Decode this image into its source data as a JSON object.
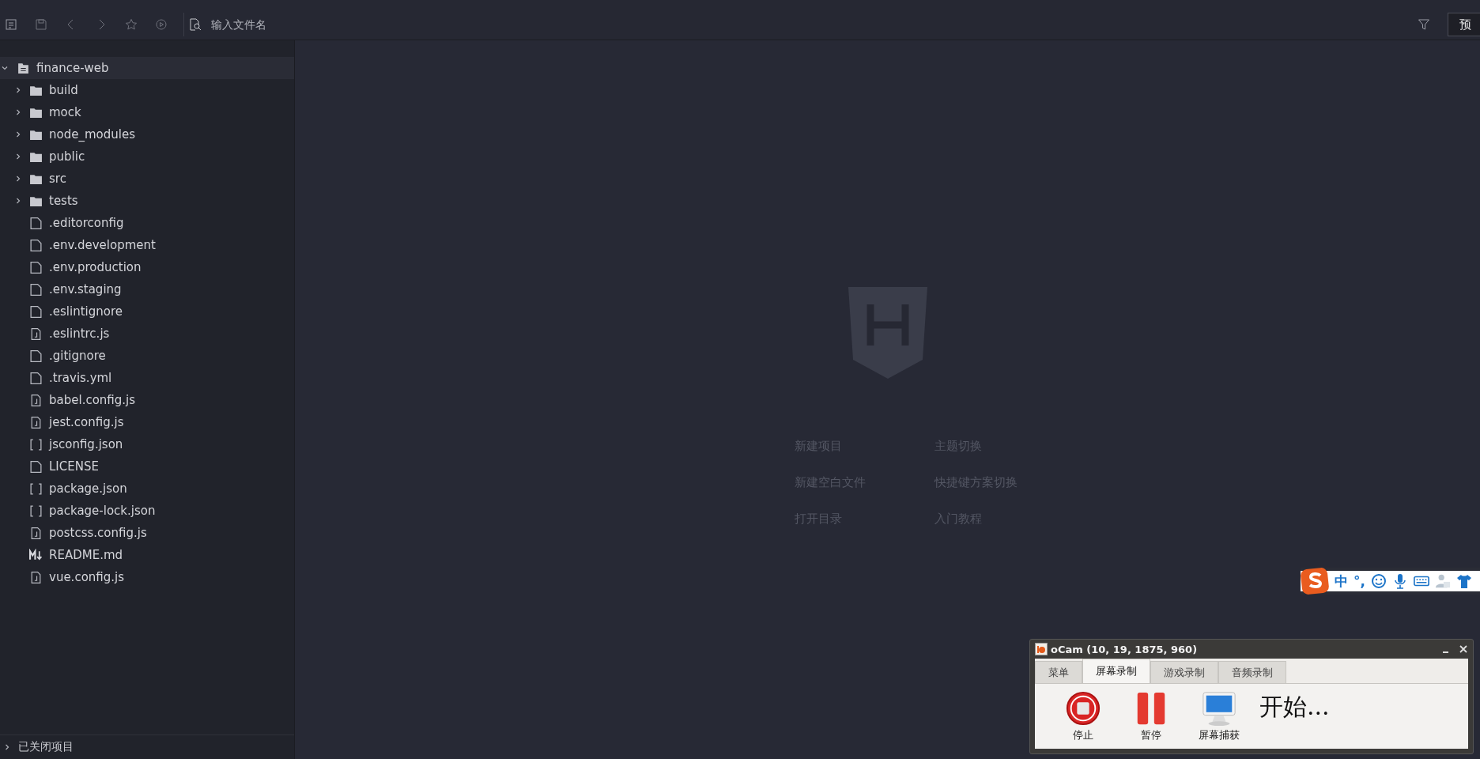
{
  "toolbar": {
    "search": {
      "placeholder": "输入文件名"
    },
    "preview_button": "预"
  },
  "sidebar": {
    "tree": [
      {
        "name": "finance-web",
        "kind": "project",
        "expanded": true,
        "children": [
          {
            "name": "build",
            "kind": "folder",
            "expanded": false
          },
          {
            "name": "mock",
            "kind": "folder",
            "expanded": false
          },
          {
            "name": "node_modules",
            "kind": "folder",
            "expanded": false
          },
          {
            "name": "public",
            "kind": "folder",
            "expanded": false
          },
          {
            "name": "src",
            "kind": "folder",
            "expanded": false
          },
          {
            "name": "tests",
            "kind": "folder",
            "expanded": false
          },
          {
            "name": ".editorconfig",
            "kind": "file"
          },
          {
            "name": ".env.development",
            "kind": "file"
          },
          {
            "name": ".env.production",
            "kind": "file"
          },
          {
            "name": ".env.staging",
            "kind": "file"
          },
          {
            "name": ".eslintignore",
            "kind": "file"
          },
          {
            "name": ".eslintrc.js",
            "kind": "js"
          },
          {
            "name": ".gitignore",
            "kind": "file"
          },
          {
            "name": ".travis.yml",
            "kind": "file"
          },
          {
            "name": "babel.config.js",
            "kind": "js"
          },
          {
            "name": "jest.config.js",
            "kind": "js"
          },
          {
            "name": "jsconfig.json",
            "kind": "json"
          },
          {
            "name": "LICENSE",
            "kind": "file"
          },
          {
            "name": "package.json",
            "kind": "json"
          },
          {
            "name": "package-lock.json",
            "kind": "json"
          },
          {
            "name": "postcss.config.js",
            "kind": "js"
          },
          {
            "name": "README.md",
            "kind": "md"
          },
          {
            "name": "vue.config.js",
            "kind": "js"
          }
        ]
      }
    ],
    "closed_projects": {
      "label": "已关闭项目",
      "expanded": false
    }
  },
  "welcome": {
    "links": [
      "新建项目",
      "主题切换",
      "新建空白文件",
      "快捷键方案切换",
      "打开目录",
      "入门教程"
    ]
  },
  "ime_bar": {
    "mode": "中",
    "punctuation": "°,"
  },
  "ocam": {
    "title": "oCam (10, 19, 1875, 960)",
    "tabs": [
      {
        "label": "菜单",
        "selected": false
      },
      {
        "label": "屏幕录制",
        "selected": true
      },
      {
        "label": "游戏录制",
        "selected": false
      },
      {
        "label": "音频录制",
        "selected": false
      }
    ],
    "buttons": [
      {
        "label": "停止",
        "kind": "stop"
      },
      {
        "label": "暂停",
        "kind": "pause"
      },
      {
        "label": "屏幕捕获",
        "kind": "capture"
      }
    ],
    "status": "开始..."
  }
}
